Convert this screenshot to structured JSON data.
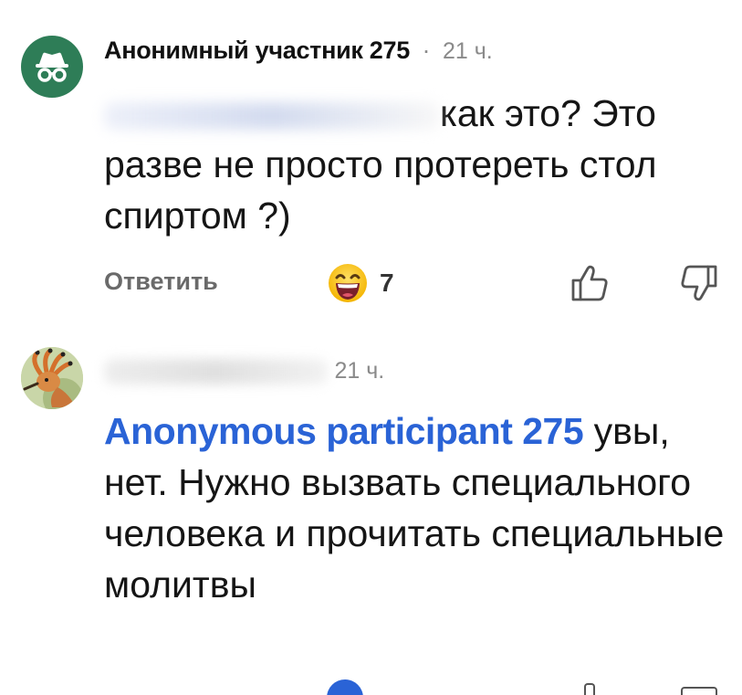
{
  "comments": [
    {
      "author": "Анонимный участник 275",
      "time": "21 ч.",
      "separator": "·",
      "text": "как это? Это разве не просто протереть стол спиртом ?)",
      "reply_label": "Ответить",
      "reaction_count": "7",
      "reaction_icon": "grinning-face-emoji",
      "avatar_icon": "incognito-icon"
    },
    {
      "time": "21 ч.",
      "mention": "Anonymous participant 275",
      "text": " увы, нет. Нужно вызвать специального человека и прочитать специальные молитвы",
      "avatar_icon": "hoopoe-bird-avatar"
    }
  ],
  "colors": {
    "mention": "#2a63d6",
    "avatar_anon_bg": "#2e7d57",
    "muted": "#8a8a8a"
  }
}
